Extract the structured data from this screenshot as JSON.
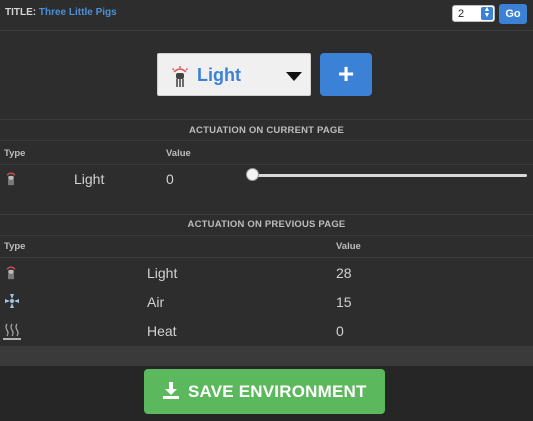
{
  "header": {
    "title_label": "TITLE:",
    "title_value": "Three Little Pigs",
    "page_number": "2",
    "go_label": "Go"
  },
  "selector": {
    "selected_type": "Light",
    "selected_icon": "light-icon",
    "add_label": "+"
  },
  "current_page": {
    "section_title": "ACTUATION ON CURRENT PAGE",
    "col_type": "Type",
    "col_value": "Value",
    "rows": [
      {
        "icon": "light-icon",
        "type": "Light",
        "value": "0",
        "slider_fraction": 0
      }
    ]
  },
  "previous_page": {
    "section_title": "ACTUATION ON PREVIOUS PAGE",
    "col_type": "Type",
    "col_value": "Value",
    "rows": [
      {
        "icon": "light-icon",
        "type": "Light",
        "value": "28"
      },
      {
        "icon": "air-icon",
        "type": "Air",
        "value": "15"
      },
      {
        "icon": "heat-icon",
        "type": "Heat",
        "value": "0"
      }
    ]
  },
  "footer": {
    "save_label": "SAVE ENVIRONMENT",
    "save_icon": "download-icon"
  },
  "colors": {
    "background": "#2d2d2d",
    "accent": "#3b82d6",
    "save_green": "#5cb85c"
  }
}
